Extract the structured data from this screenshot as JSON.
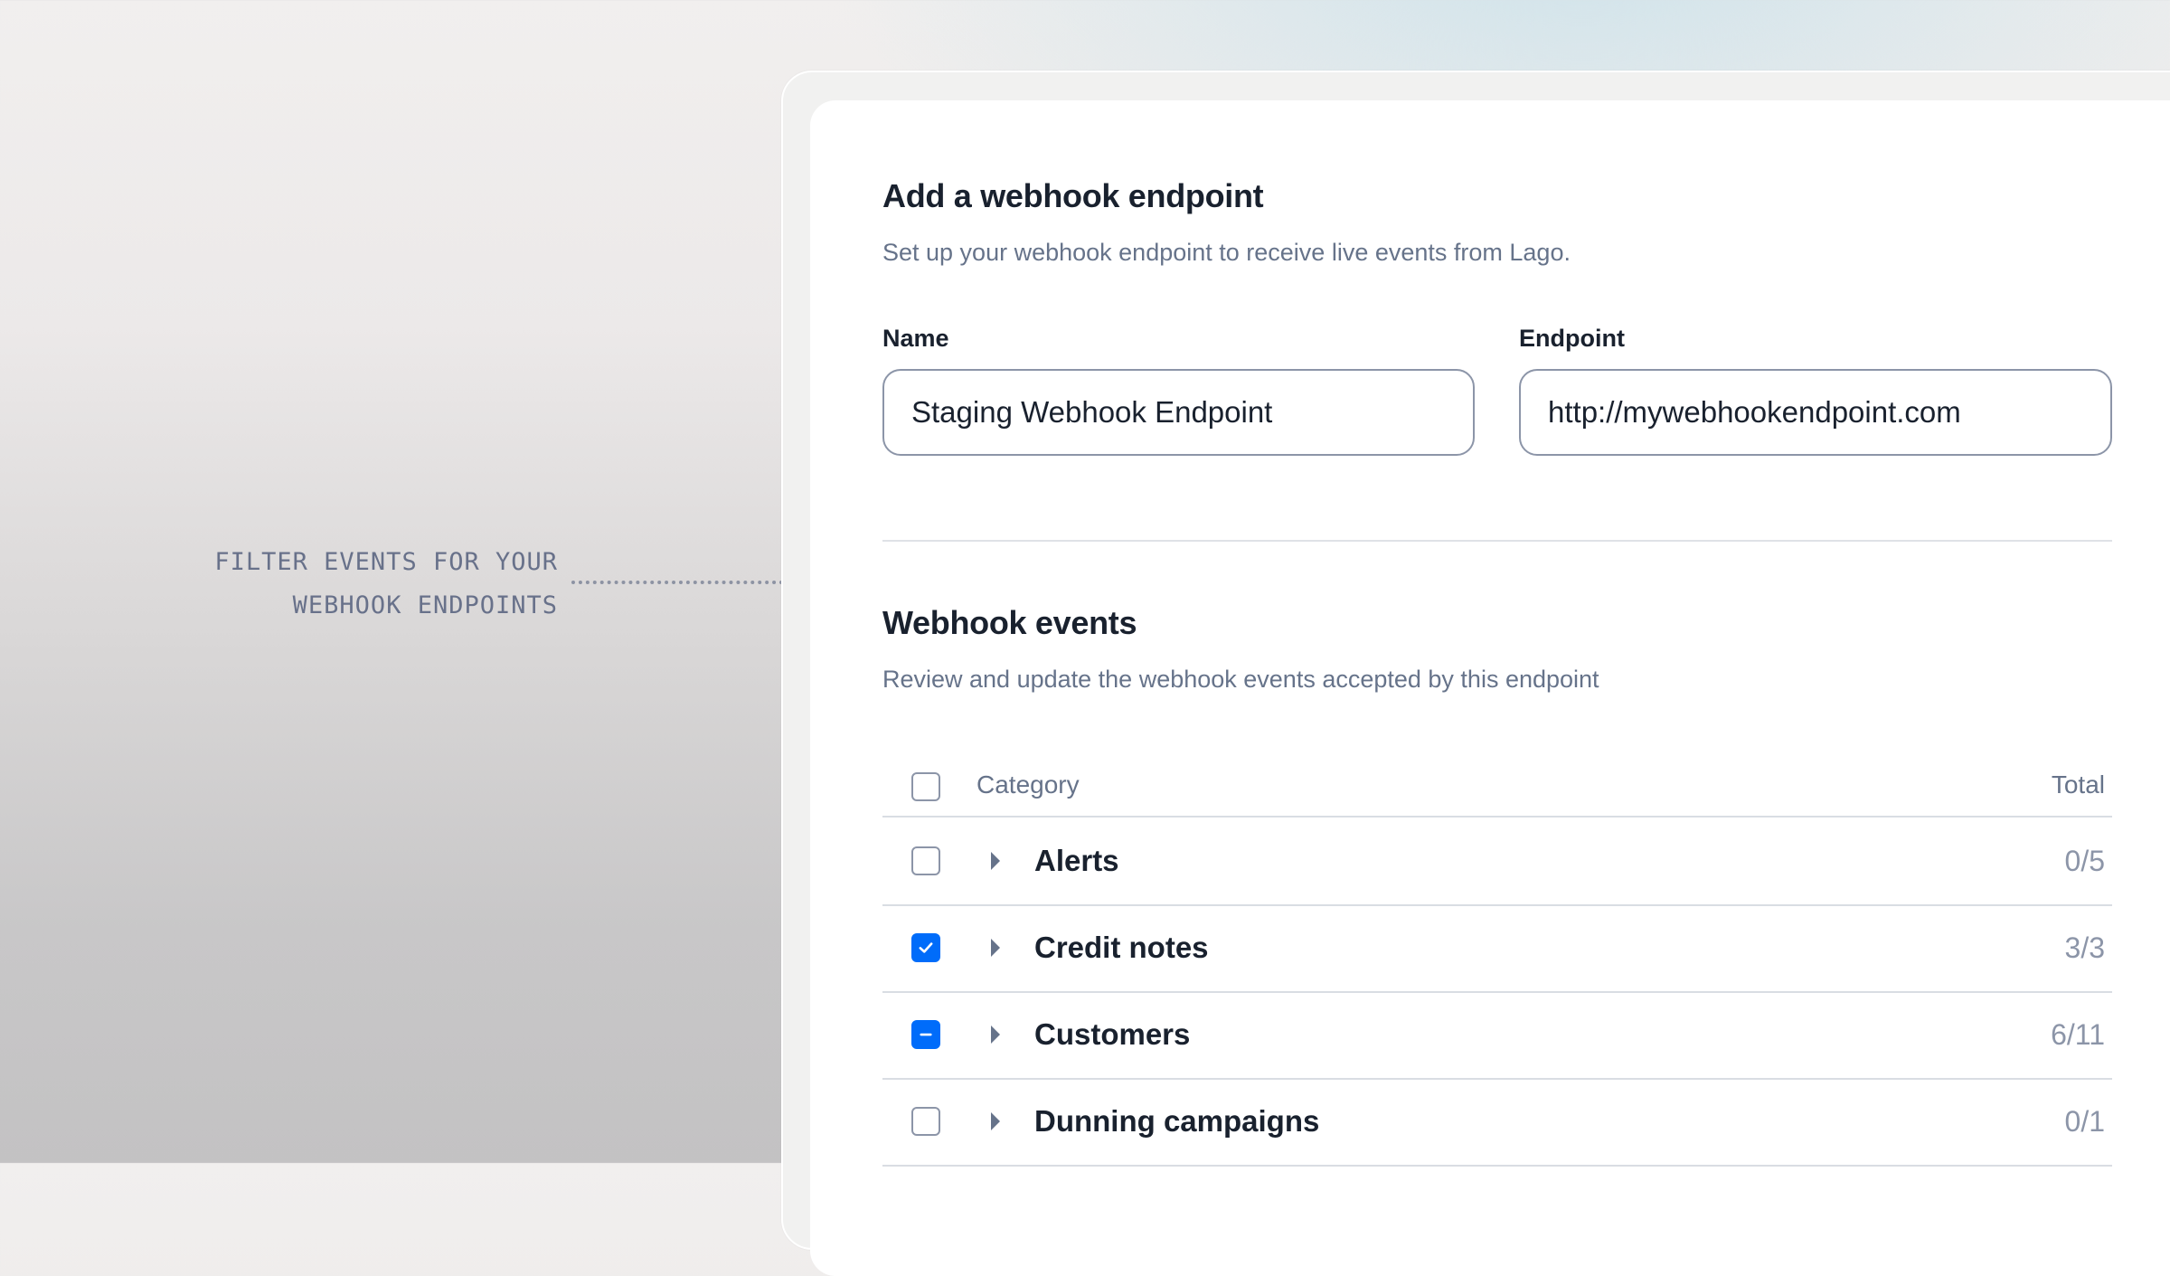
{
  "annotation": {
    "line1": "FILTER EVENTS FOR YOUR",
    "line2": "WEBHOOK ENDPOINTS"
  },
  "endpoint_form": {
    "title": "Add a webhook endpoint",
    "description": "Set up your webhook endpoint to receive live events from Lago.",
    "name_label": "Name",
    "name_value": "Staging Webhook Endpoint",
    "endpoint_label": "Endpoint",
    "endpoint_value": "http://mywebhookendpoint.com"
  },
  "events": {
    "title": "Webhook events",
    "description": "Review and update the webhook events accepted by this endpoint",
    "columns": {
      "category": "Category",
      "total": "Total"
    },
    "rows": [
      {
        "label": "Alerts",
        "total": "0/5",
        "state": "unchecked"
      },
      {
        "label": "Credit notes",
        "total": "3/3",
        "state": "checked"
      },
      {
        "label": "Customers",
        "total": "6/11",
        "state": "partial"
      },
      {
        "label": "Dunning campaigns",
        "total": "0/1",
        "state": "unchecked"
      }
    ]
  },
  "colors": {
    "accent": "#006cfa",
    "text_primary": "#19212e",
    "text_secondary": "#66738a",
    "border": "#8c95a8"
  }
}
